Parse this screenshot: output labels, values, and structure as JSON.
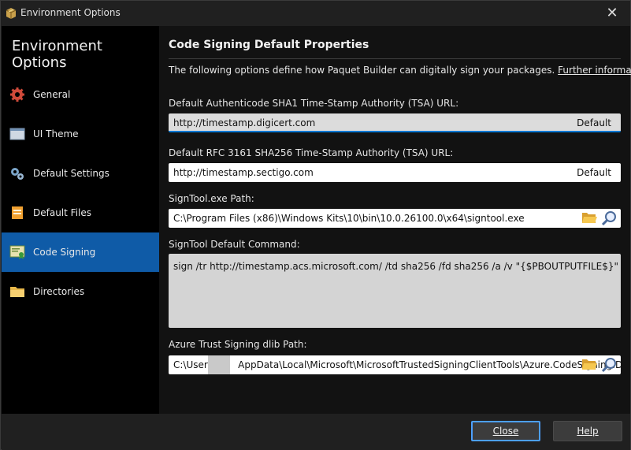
{
  "window": {
    "title": "Environment Options",
    "close_glyph": "✕"
  },
  "sidebar": {
    "heading": "Environment Options",
    "items": [
      {
        "label": "General",
        "icon": "gear-icon"
      },
      {
        "label": "UI Theme",
        "icon": "window-icon"
      },
      {
        "label": "Default Settings",
        "icon": "gears-icon"
      },
      {
        "label": "Default Files",
        "icon": "file-icon"
      },
      {
        "label": "Code Signing",
        "icon": "certificate-icon",
        "active": true
      },
      {
        "label": "Directories",
        "icon": "folder-icon"
      }
    ]
  },
  "content": {
    "heading": "Code Signing Default Properties",
    "intro": "The following options define how Paquet Builder can digitally sign your packages.",
    "intro_link": "Further information",
    "sha1_label": "Default Authenticode SHA1 Time-Stamp Authority (TSA) URL:",
    "sha1_value": "http://timestamp.digicert.com",
    "sha256_label": "Default RFC 3161 SHA256 Time-Stamp Authority (TSA) URL:",
    "sha256_value": "http://timestamp.sectigo.com",
    "default_label": "Default",
    "signtool_label": "SignTool.exe Path:",
    "signtool_value": "C:\\Program Files (x86)\\Windows Kits\\10\\bin\\10.0.26100.0\\x64\\signtool.exe",
    "command_label": "SignTool Default Command:",
    "command_value": "sign /tr http://timestamp.acs.microsoft.com/ /td sha256 /fd sha256 /a /v \"{$PBOUTPUTFILE$}\"",
    "dlib_label": "Azure Trust Signing dlib Path:",
    "dlib_value_prefix": "C:\\Users\\",
    "dlib_value_suffix": "AppData\\Local\\Microsoft\\MicrosoftTrustedSigningClientTools\\Azure.CodeSigning.D"
  },
  "footer": {
    "close_label": "Close",
    "help_label": "Help"
  },
  "colors": {
    "accent": "#0f5ba7",
    "focus": "#0078d4"
  }
}
